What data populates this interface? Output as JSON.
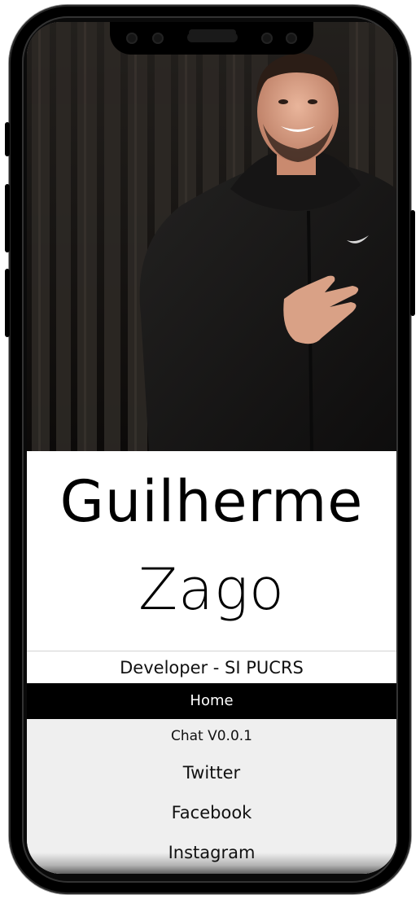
{
  "profile": {
    "first_name": "Guilherme",
    "last_name": "Zago",
    "subtitle": "Developer - SI PUCRS",
    "photo": "profile-photo"
  },
  "nav": {
    "items": [
      {
        "label": "Home",
        "active": true
      },
      {
        "label": "Chat V0.0.1",
        "active": false
      },
      {
        "label": "Twitter",
        "active": false
      },
      {
        "label": "Facebook",
        "active": false
      },
      {
        "label": "Instagram",
        "active": false
      }
    ]
  },
  "colors": {
    "frame": "#000000",
    "nav_active_bg": "#000000",
    "nav_active_text": "#ffffff",
    "nav_bg": "#efefef",
    "text": "#000000"
  }
}
